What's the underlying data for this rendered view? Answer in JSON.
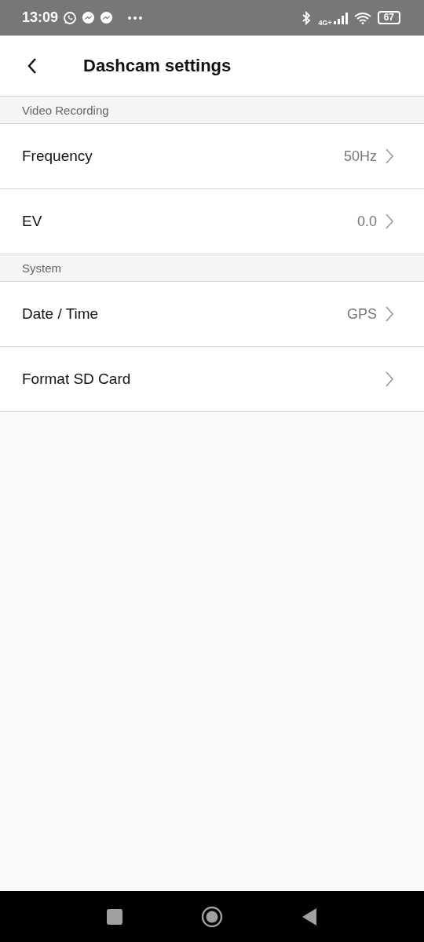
{
  "status_bar": {
    "time": "13:09",
    "network": "4G+",
    "battery": "67"
  },
  "header": {
    "title": "Dashcam settings"
  },
  "sections": [
    {
      "title": "Video Recording",
      "items": [
        {
          "label": "Frequency",
          "value": "50Hz"
        },
        {
          "label": "EV",
          "value": "0.0"
        }
      ]
    },
    {
      "title": "System",
      "items": [
        {
          "label": "Date / Time",
          "value": "GPS"
        },
        {
          "label": "Format SD Card"
        }
      ]
    }
  ]
}
